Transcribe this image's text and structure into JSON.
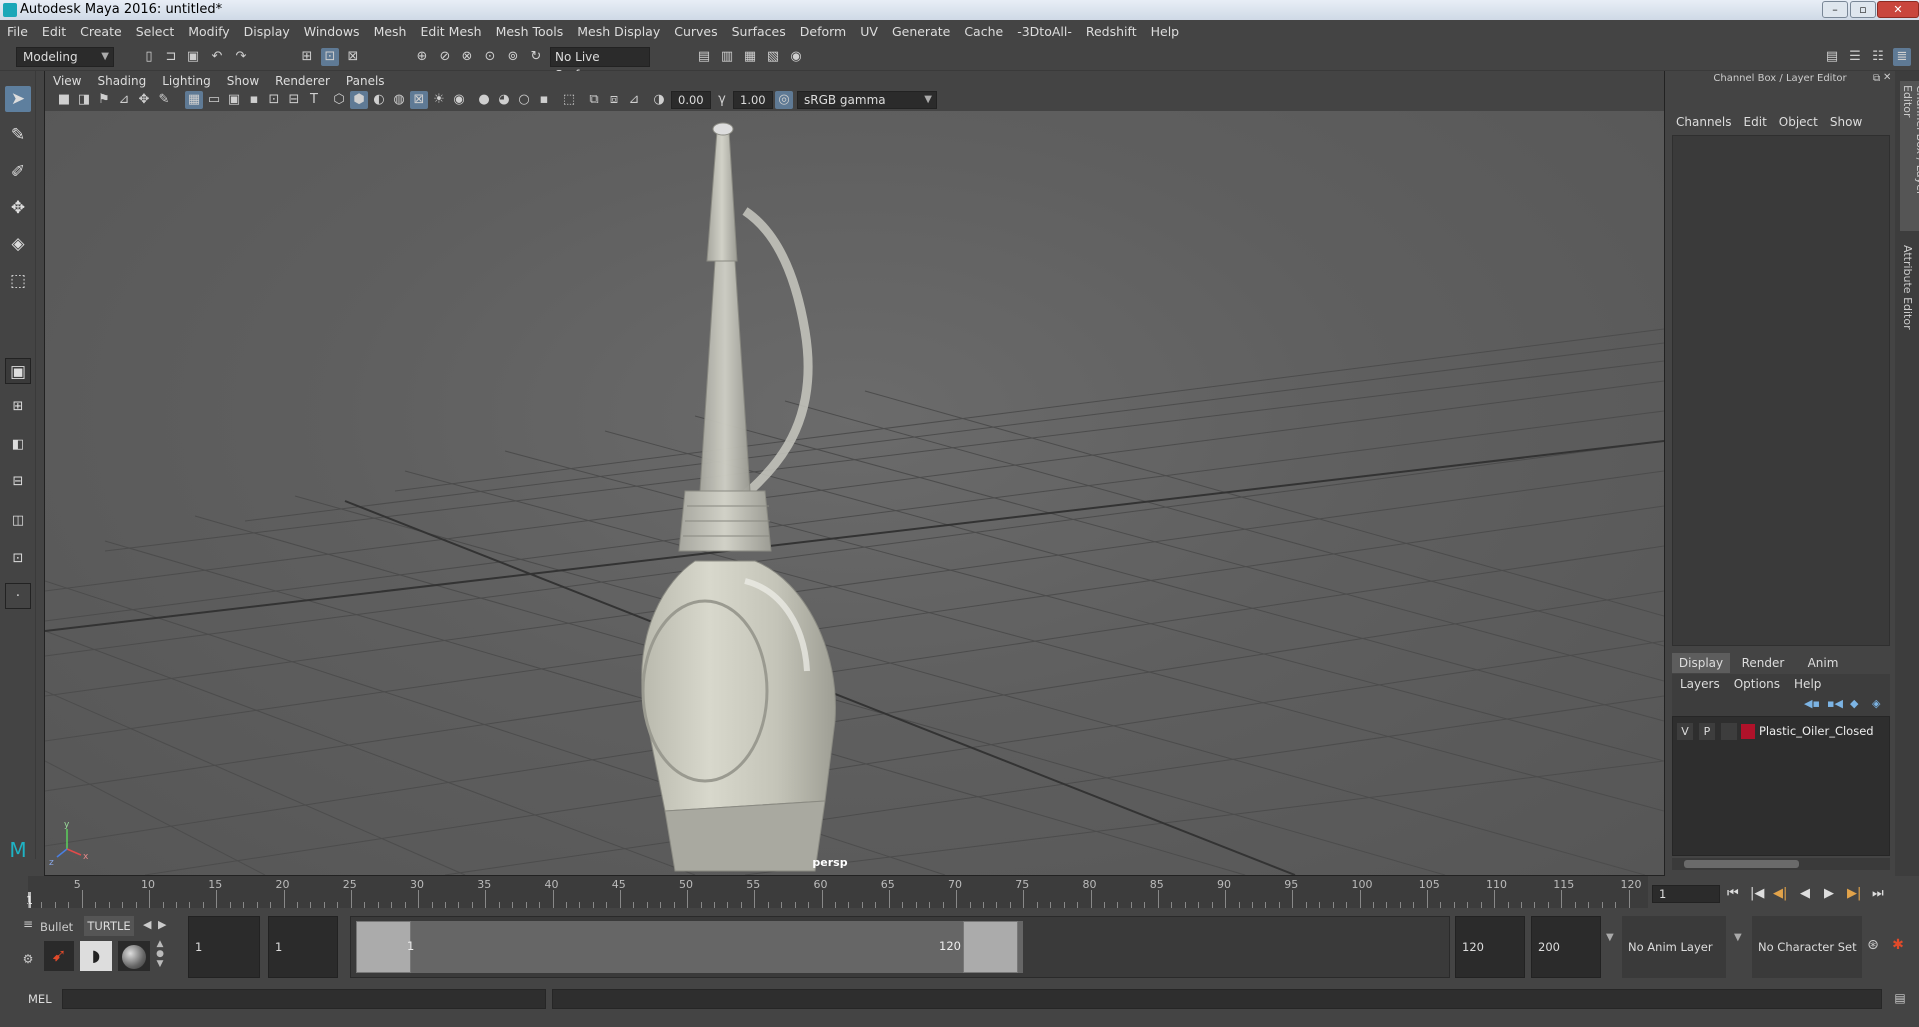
{
  "window": {
    "title": "Autodesk Maya 2016: untitled*",
    "buttons": [
      "–",
      "▫",
      "✕"
    ]
  },
  "menubar": {
    "items": [
      "File",
      "Edit",
      "Create",
      "Select",
      "Modify",
      "Display",
      "Windows",
      "Mesh",
      "Edit Mesh",
      "Mesh Tools",
      "Mesh Display",
      "Curves",
      "Surfaces",
      "Deform",
      "UV",
      "Generate",
      "Cache",
      "-3DtoAll-",
      "Redshift",
      "Help"
    ]
  },
  "shelf": {
    "mode": "Modeling",
    "live_surface": "No Live Surface"
  },
  "viewport": {
    "menus": [
      "View",
      "Shading",
      "Lighting",
      "Show",
      "Renderer",
      "Panels"
    ],
    "exposure": "0.00",
    "gamma": "1.00",
    "color_space": "sRGB gamma",
    "camera_label": "persp",
    "axis": {
      "x": "x",
      "y": "y",
      "z": "z"
    }
  },
  "channel_box": {
    "header": "Channel Box / Layer Editor",
    "menus": [
      "Channels",
      "Edit",
      "Object",
      "Show"
    ]
  },
  "layer_editor": {
    "tabs": [
      "Display",
      "Render",
      "Anim"
    ],
    "active_tab": "Display",
    "menus": [
      "Layers",
      "Options",
      "Help"
    ],
    "layers": [
      {
        "v": "V",
        "p": "P",
        "name": "Plastic_Oiler_Closed",
        "color": "#b0122a"
      }
    ]
  },
  "side_tabs": [
    "Channel Box / Layer Editor",
    "Attribute Editor"
  ],
  "timeline": {
    "ticks": [
      5,
      10,
      15,
      20,
      25,
      30,
      35,
      40,
      45,
      50,
      55,
      60,
      65,
      70,
      75,
      80,
      85,
      90,
      95,
      100,
      105,
      110,
      115,
      120
    ],
    "start_label": "1",
    "current_frame": "1",
    "playback_buttons": [
      "⏮",
      "|◀",
      "◀|",
      "◀",
      "▶",
      "▶|",
      "⏭"
    ]
  },
  "range": {
    "shelf_tabs": [
      "Bullet",
      "TURTLE"
    ],
    "start_frame": "1",
    "playback_start": "1",
    "range_start_label": "1",
    "range_end_label": "120",
    "playback_end": "120",
    "end_frame": "200",
    "anim_layer": "No Anim Layer",
    "character_set": "No Character Set"
  },
  "command_line": {
    "label": "MEL"
  }
}
